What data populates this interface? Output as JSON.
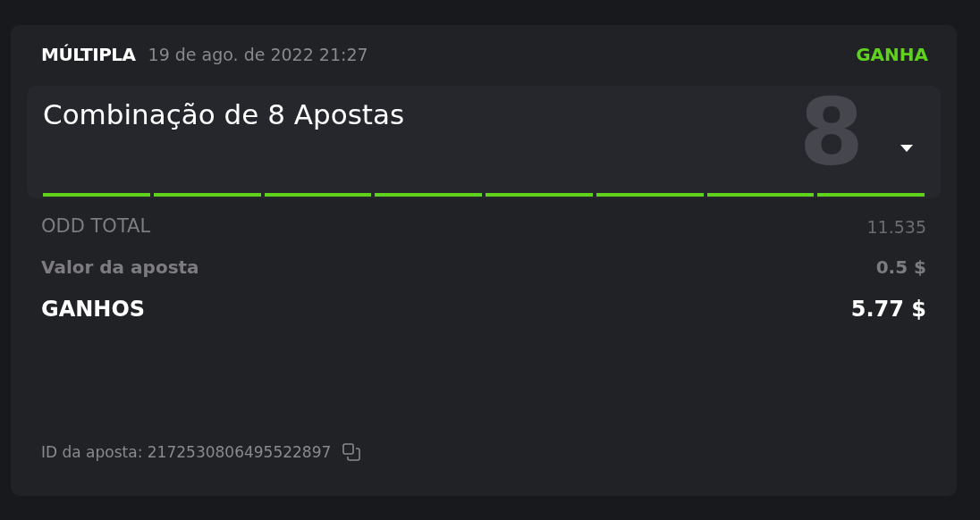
{
  "bet": {
    "type": "MÚLTIPLA",
    "date": "19 de ago. de 2022 21:27",
    "status": "GANHA",
    "won": true
  },
  "combo": {
    "title": "Combinação de 8 Apostas",
    "count": "8",
    "expanded": false,
    "legs": [
      {
        "color": "#5fd31c"
      },
      {
        "color": "#5fd31c"
      },
      {
        "color": "#5fd31c"
      },
      {
        "color": "#5fd31c"
      },
      {
        "color": "#5fd31c"
      },
      {
        "color": "#5fd31c"
      },
      {
        "color": "#5fd31c"
      },
      {
        "color": "#5fd31c"
      }
    ]
  },
  "summary": [
    {
      "kind": "light",
      "label": "ODD TOTAL",
      "value": "11.535"
    },
    {
      "kind": "bold",
      "label": "Valor da aposta",
      "value": "0.5 $"
    },
    {
      "kind": "strong",
      "label": "GANHOS",
      "value": "5.77 $"
    }
  ],
  "footer": {
    "bet_id": "ID da aposta: 2172530806495522897"
  }
}
